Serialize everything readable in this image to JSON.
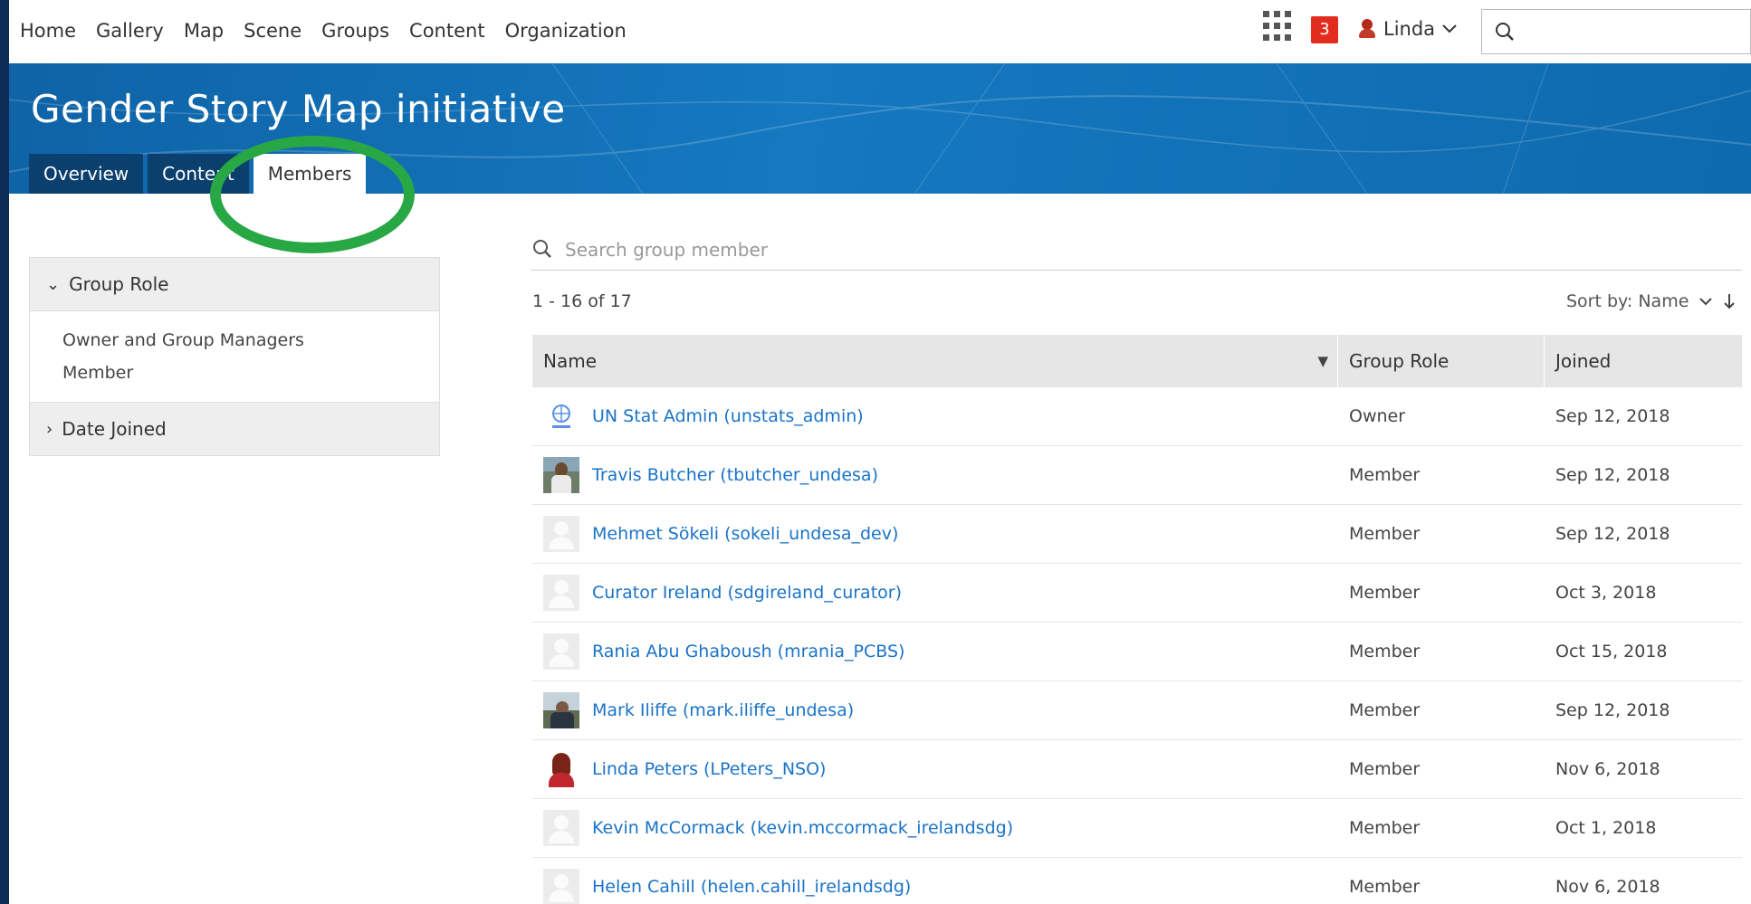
{
  "nav": {
    "links": [
      "Home",
      "Gallery",
      "Map",
      "Scene",
      "Groups",
      "Content",
      "Organization"
    ],
    "notification_count": "3",
    "user_name": "Linda"
  },
  "group": {
    "title": "Gender Story Map initiative",
    "tabs": [
      "Overview",
      "Content",
      "Members"
    ],
    "active_tab": "Members"
  },
  "filters": {
    "group_role": {
      "label": "Group Role",
      "options": [
        "Owner and Group Managers",
        "Member"
      ]
    },
    "date_joined": {
      "label": "Date Joined"
    }
  },
  "search": {
    "placeholder": "Search group member"
  },
  "results": {
    "count_text": "1 - 16 of 17",
    "sort_text": "Sort by: Name"
  },
  "table": {
    "headers": {
      "name": "Name",
      "role": "Group Role",
      "joined": "Joined"
    },
    "rows": [
      {
        "name": "UN Stat Admin (unstats_admin)",
        "role": "Owner",
        "joined": "Sep 12, 2018",
        "avatar": "un-logo"
      },
      {
        "name": "Travis Butcher (tbutcher_undesa)",
        "role": "Member",
        "joined": "Sep 12, 2018",
        "avatar": "photo1"
      },
      {
        "name": "Mehmet Sökeli (sokeli_undesa_dev)",
        "role": "Member",
        "joined": "Sep 12, 2018",
        "avatar": "placeholder"
      },
      {
        "name": "Curator Ireland (sdgireland_curator)",
        "role": "Member",
        "joined": "Oct 3, 2018",
        "avatar": "placeholder"
      },
      {
        "name": "Rania Abu Ghaboush (mrania_PCBS)",
        "role": "Member",
        "joined": "Oct 15, 2018",
        "avatar": "placeholder"
      },
      {
        "name": "Mark Iliffe (mark.iliffe_undesa)",
        "role": "Member",
        "joined": "Sep 12, 2018",
        "avatar": "photo2"
      },
      {
        "name": "Linda Peters (LPeters_NSO)",
        "role": "Member",
        "joined": "Nov 6, 2018",
        "avatar": "photo3"
      },
      {
        "name": "Kevin McCormack (kevin.mccormack_irelandsdg)",
        "role": "Member",
        "joined": "Oct 1, 2018",
        "avatar": "placeholder"
      },
      {
        "name": "Helen Cahill (helen.cahill_irelandsdg)",
        "role": "Member",
        "joined": "Nov 6, 2018",
        "avatar": "placeholder"
      }
    ]
  },
  "colors": {
    "banner": "#1275bd",
    "tab_dark": "#0b3f6e",
    "link": "#1a73c8",
    "highlight_ring": "#28a745",
    "badge": "#e22c1d"
  }
}
